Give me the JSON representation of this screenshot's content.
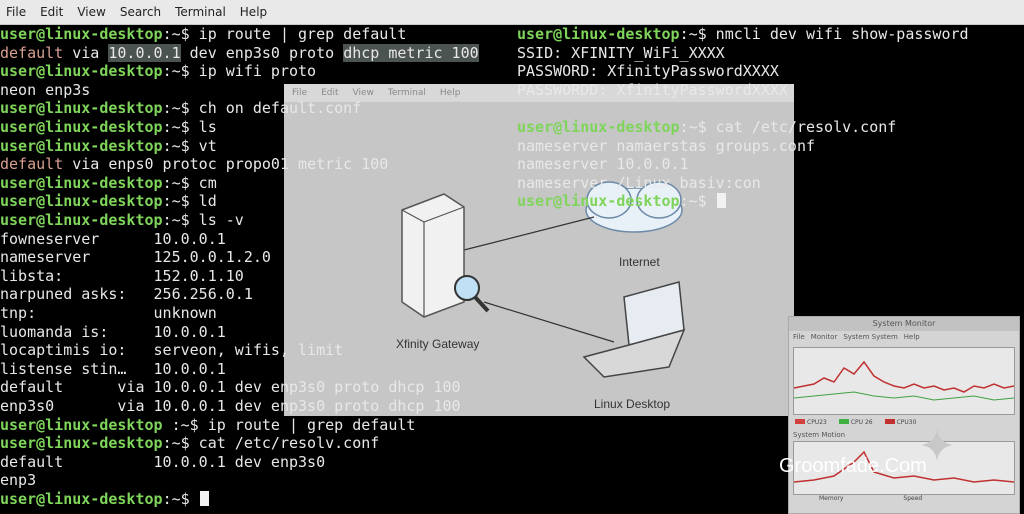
{
  "menubar": [
    "File",
    "Edit",
    "View",
    "Search",
    "Terminal",
    "Help"
  ],
  "prompt": "user@linux-desktop",
  "left_lines": [
    {
      "prompt": true,
      "cmd": ":~$ ip route | grep default"
    },
    {
      "kind": "route_hl",
      "parts": [
        "default",
        " via ",
        "10.0.0.1",
        " dev enp3s0 proto ",
        "dhcp metric 100"
      ]
    },
    {
      "prompt": true,
      "cmd": ":~$ ip wifi proto"
    },
    {
      "text": "neon enp3s"
    },
    {
      "prompt": true,
      "cmd": ":~$ ch on default.conf"
    },
    {
      "prompt": true,
      "cmd": ":~$ ls"
    },
    {
      "prompt": true,
      "cmd": ":~$ vt"
    },
    {
      "kind": "red_first",
      "parts": [
        "default",
        " via enps0 protoc propo01 metric 100"
      ]
    },
    {
      "prompt": true,
      "cmd": ":~$ cm"
    },
    {
      "prompt": true,
      "cmd": ":~$ ld"
    },
    {
      "prompt": true,
      "cmd": ":~$ ls -v"
    },
    {
      "text": "fowneserver      10.0.0.1"
    },
    {
      "text": "nameserver       125.0.0.1.2.0"
    },
    {
      "text": "libsta:          152.0.1.10"
    },
    {
      "text": "narpuned asks:   256.256.0.1"
    },
    {
      "text": "tnp:             unknown"
    },
    {
      "text": "luomanda is:     10.0.0.1"
    },
    {
      "text": "locaptimis io:   serveon, wifis, limit"
    },
    {
      "text": "listense stin…   10.0.0.1"
    },
    {
      "text": "default      via 10.0.0.1 dev enp3s0 proto dhcp 100"
    },
    {
      "text": "enp3s0       via 10.0.0.1 dev enp3s0 proto dhcp 100"
    },
    {
      "prompt": true,
      "cmd": " :~$ ip route | grep default"
    },
    {
      "prompt": true,
      "cmd": ":~$ cat /etc/resolv.conf"
    },
    {
      "text": "default          10.0.0.1 dev enp3s0"
    },
    {
      "text": "enp3"
    },
    {
      "prompt": true,
      "cmd": ":~$ ",
      "cursor": true
    }
  ],
  "right_lines": [
    {
      "prompt": true,
      "cmd": ":~$ nmcli dev wifi show-password"
    },
    {
      "text": "SSID: XFINITY_WiFi_XXXX"
    },
    {
      "text": "PASSWORD: XfinityPasswordXXXX"
    },
    {
      "text": "PASSWORDD: XfinityPasswordXXXX"
    },
    {
      "text": ""
    },
    {
      "prompt": true,
      "cmd": ":~$ cat /etc/resolv.conf"
    },
    {
      "text": "nameserver namaerstas groups.conf"
    },
    {
      "text": "nameserver 10.0.0.1"
    },
    {
      "text": "nameserver /Linux basiv:con"
    },
    {
      "prompt": true,
      "cmd": ":~$ ",
      "cursor": true
    }
  ],
  "background_window": {
    "menu": [
      "File",
      "Edit",
      "View",
      "Terminal",
      "Help"
    ],
    "labels": {
      "gateway": "Xfinity Gateway",
      "internet": "Internet",
      "desktop": "Linux Desktop"
    }
  },
  "system_monitor": {
    "title": "System Monitor",
    "menu": [
      "File",
      "Monitor",
      "System System",
      "Help"
    ],
    "legend": [
      "CPU23",
      "CPU 26",
      "CPU30"
    ],
    "legend_colors": [
      "#d04040",
      "#40b040",
      "#c03030"
    ],
    "history_label": "System Motion",
    "bottom": [
      "Memory",
      "Speed"
    ]
  },
  "watermark": "Groomfade.Com"
}
